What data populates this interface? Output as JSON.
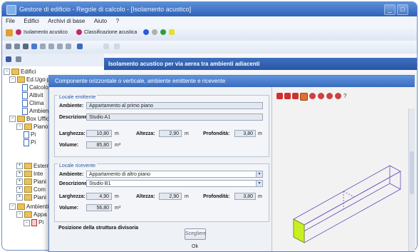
{
  "window": {
    "title": "Gestore di edificio - Regole di calcolo - [Isolamento acustico]",
    "controls": {
      "minimize": "_",
      "maximize": "□"
    }
  },
  "menu": [
    "File",
    "Edifici",
    "Archivi di base",
    "Aiuto",
    "?"
  ],
  "toolbar1": {
    "tab1_label": "Isolamento acustico",
    "tab2_label": "Classificazione acustica"
  },
  "tree": {
    "root": "Edifici",
    "items": [
      "Ed.Ugo primo",
      "Calcolo",
      "Attivit",
      "Clima",
      "Ambienti",
      "Box Ufficio",
      "Piano",
      "Pi",
      "Pi",
      "Esterni",
      "Inte",
      "Piani",
      "Com",
      "Piani",
      "Ambienti",
      "Appa",
      "Pi"
    ]
  },
  "right_header": "Isolamento acustico per via aerea tra ambienti adiacenti",
  "dialog": {
    "title": "Componente orizzontale o verticale, ambiente emittente e ricevente",
    "emitting_group": {
      "title": "Locale emittente",
      "ambiente_label": "Ambiente:",
      "ambiente_value": "Appartamento al primo piano",
      "descrizione_label": "Descrizione:",
      "descrizione_value": "Studio A1",
      "larghezza_label": "Larghezza:",
      "larghezza_value": "10,80",
      "altezza_label": "Altezza:",
      "altezza_value": "2,90",
      "profondita_label": "Profondità:",
      "profondita_value": "3,80",
      "volume_label": "Volume:",
      "volume_value": "85,80",
      "unit_m": "m",
      "unit_m3": "m³"
    },
    "receiving_group": {
      "title": "Locale ricevente",
      "ambiente_label": "Ambiente:",
      "ambiente_value": "Appartamento di altro piano",
      "descrizione_label": "Descrizione:",
      "descrizione_value": "Studio B1",
      "larghezza_label": "Larghezza:",
      "larghezza_value": "4,90",
      "altezza_label": "Altezza:",
      "altezza_value": "2,90",
      "profondita_label": "Profondità:",
      "profondita_value": "3,80",
      "volume_label": "Volume:",
      "volume_value": "56,80",
      "unit_m": "m",
      "unit_m3": "m³"
    },
    "position_label": "Posizione della struttura divisoria",
    "button_inserisci": "Scegliere",
    "ok_label": "Ok"
  },
  "colors": {
    "title_blue": "#3a6cc0",
    "panel_green": "#c8f020",
    "wireframe": "#6a4ab8"
  }
}
